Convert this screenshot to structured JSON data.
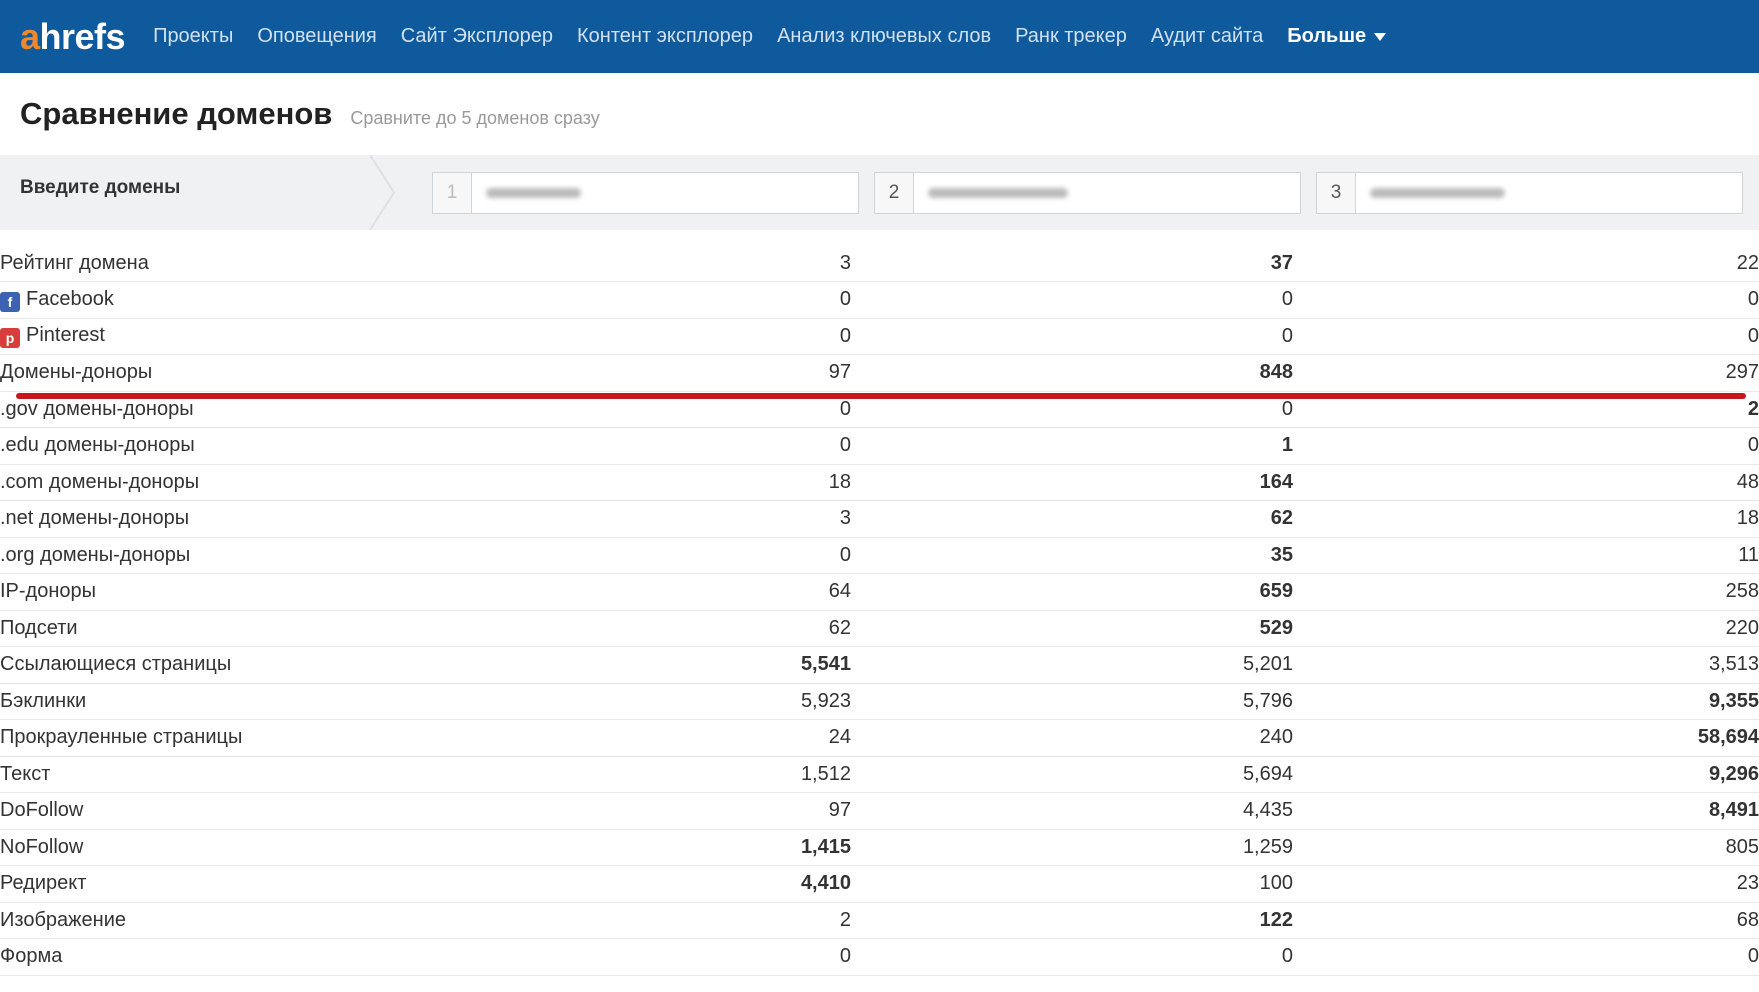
{
  "logo": {
    "a": "a",
    "rest": "hrefs"
  },
  "nav": {
    "items": [
      "Проекты",
      "Оповещения",
      "Сайт Эксплорер",
      "Контент эксплорер",
      "Анализ ключевых слов",
      "Ранк трекер",
      "Аудит сайта"
    ],
    "more": "Больше"
  },
  "header": {
    "title": "Сравнение доменов",
    "subtitle": "Сравните до 5 доменов сразу"
  },
  "domains": {
    "label": "Введите домены",
    "fields": [
      {
        "num": "1"
      },
      {
        "num": "2"
      },
      {
        "num": "3"
      }
    ]
  },
  "colors": {
    "nav_bg": "#0f5a9c",
    "logo_accent": "#f0882b",
    "highlight_line": "#c8161d"
  },
  "rows": [
    {
      "label": "Рейтинг домена",
      "v": [
        "3",
        "37",
        "22"
      ],
      "bold": 1
    },
    {
      "label": "Facebook",
      "icon": "facebook-icon",
      "v": [
        "0",
        "0",
        "0"
      ],
      "bold": -1
    },
    {
      "label": "Pinterest",
      "icon": "pinterest-icon",
      "v": [
        "0",
        "0",
        "0"
      ],
      "bold": -1
    },
    {
      "label": "Домены-доноры",
      "v": [
        "97",
        "848",
        "297"
      ],
      "bold": 1
    },
    {
      "label": ".gov домены-доноры",
      "v": [
        "0",
        "0",
        "2"
      ],
      "bold": 2
    },
    {
      "label": ".edu домены-доноры",
      "v": [
        "0",
        "1",
        "0"
      ],
      "bold": 1
    },
    {
      "label": ".com домены-доноры",
      "v": [
        "18",
        "164",
        "48"
      ],
      "bold": 1
    },
    {
      "label": ".net домены-доноры",
      "v": [
        "3",
        "62",
        "18"
      ],
      "bold": 1
    },
    {
      "label": ".org домены-доноры",
      "v": [
        "0",
        "35",
        "11"
      ],
      "bold": 1
    },
    {
      "label": "IP-доноры",
      "v": [
        "64",
        "659",
        "258"
      ],
      "bold": 1
    },
    {
      "label": "Подсети",
      "v": [
        "62",
        "529",
        "220"
      ],
      "bold": 1
    },
    {
      "label": "Ссылающиеся страницы",
      "v": [
        "5,541",
        "5,201",
        "3,513"
      ],
      "bold": 0
    },
    {
      "label": "Бэклинки",
      "v": [
        "5,923",
        "5,796",
        "9,355"
      ],
      "bold": 2
    },
    {
      "label": "Прокрауленные страницы",
      "v": [
        "24",
        "240",
        "58,694"
      ],
      "bold": 2
    },
    {
      "label": "Текст",
      "v": [
        "1,512",
        "5,694",
        "9,296"
      ],
      "bold": 2
    },
    {
      "label": "DoFollow",
      "v": [
        "97",
        "4,435",
        "8,491"
      ],
      "bold": 2
    },
    {
      "label": "NoFollow",
      "v": [
        "1,415",
        "1,259",
        "805"
      ],
      "bold": 0
    },
    {
      "label": "Редирект",
      "v": [
        "4,410",
        "100",
        "23"
      ],
      "bold": 0
    },
    {
      "label": "Изображение",
      "v": [
        "2",
        "122",
        "68"
      ],
      "bold": 1
    },
    {
      "label": "Форма",
      "v": [
        "0",
        "0",
        "0"
      ],
      "bold": -1
    }
  ]
}
